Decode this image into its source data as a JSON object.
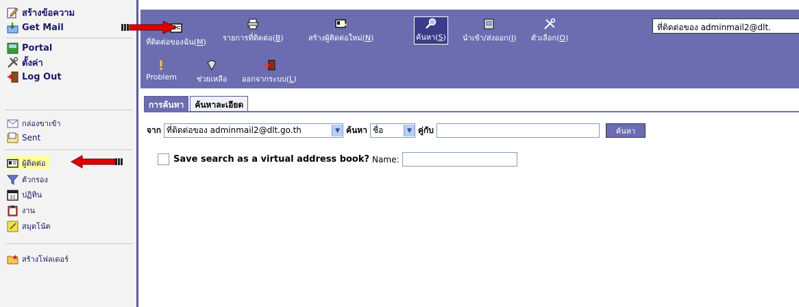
{
  "sidebar": {
    "compose": "สร้างข้อความ",
    "get_mail": "Get Mail",
    "portal": "Portal",
    "settings": "ตั้งค่า",
    "logout": "Log Out",
    "inbox": "กล่องขาเข้า",
    "sent": "Sent",
    "contacts": "ผู้ติดต่อ",
    "filters": "ตัวกรอง",
    "calendar": "ปฏิทิน",
    "tasks": "งาน",
    "notes": "สมุดโน้ต",
    "new_folder": "สร้างโฟลเดอร์"
  },
  "toolbar": {
    "my_contacts": "ที่ติดต่อของฉัน(",
    "my_contacts_key": "M",
    "contact_lists": "รายการที่ติดต่อ(",
    "contact_lists_key": "B",
    "new_contact": "สร้างผู้ติดต่อใหม่(",
    "new_contact_key": "N",
    "search": "ค้นหา(",
    "search_key": "S",
    "import_export": "นำเข้า/ส่งออก(",
    "import_export_key": "I",
    "options": "ตัวเลือก(",
    "options_key": "O",
    "problem": "Problem",
    "help": "ช่วยเหลือ",
    "logout": "ออกจากระบบ(",
    "logout_key": "L",
    "close_paren": ")",
    "addressbook_value": "ที่ติดต่อของ adminmail2@dlt."
  },
  "tabs": {
    "search": "การค้นหา",
    "advanced": "ค้นหาละเอียด"
  },
  "search": {
    "from_label": "จาก",
    "source_value": "ที่ติดต่อของ adminmail2@dlt.go.th",
    "find_label": "ค้นหา",
    "field_value": "ชื่อ",
    "match_label": "คู่กับ",
    "query_value": "",
    "submit_label": "ค้นหา",
    "save_label": "Save search as a virtual address book?",
    "name_label": "Name:",
    "name_value": ""
  },
  "colors": {
    "toolbar_bg": "#6b6db0",
    "arrow_red": "#e00000"
  }
}
